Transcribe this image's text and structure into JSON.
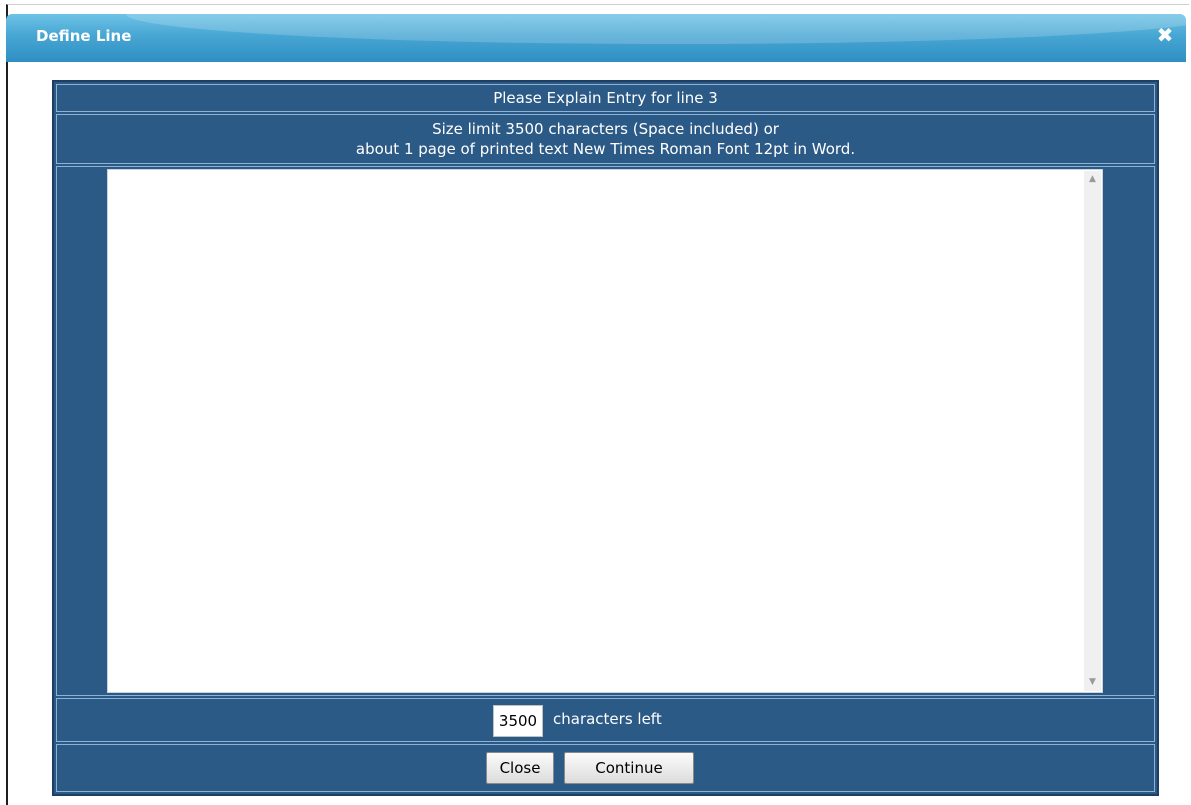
{
  "dialog": {
    "title": "Define Line",
    "close_glyph": "✖"
  },
  "form": {
    "heading": "Please Explain Entry for line 3",
    "limit_line1": "Size limit 3500 characters (Space included) or",
    "limit_line2": "about 1 page of printed text New Times Roman Font 12pt in Word.",
    "explanation_value": "",
    "chars_left_value": "3500",
    "chars_left_label": "characters left",
    "close_label": "Close",
    "continue_label": "Continue"
  },
  "colors": {
    "titlebar": "#47a6d3",
    "panel": "#2c5a87",
    "panel_border": "#8fb2d4"
  },
  "icons": {
    "close": "close-icon",
    "scroll_up": "scroll-up-arrow-icon",
    "scroll_down": "scroll-down-arrow-icon"
  }
}
